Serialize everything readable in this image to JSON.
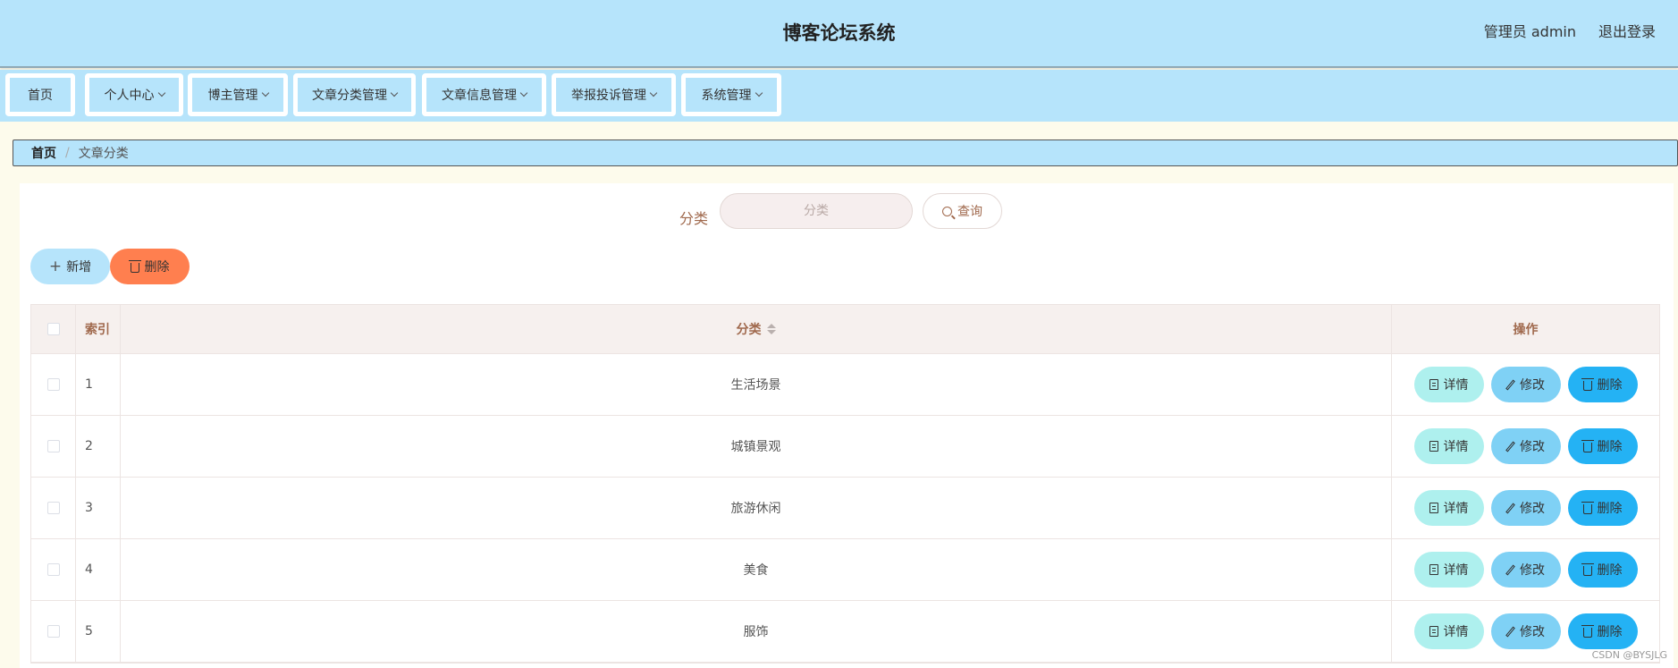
{
  "header": {
    "title": "博客论坛系统",
    "user": "管理员 admin",
    "logout": "退出登录"
  },
  "menu": [
    {
      "label": "首页",
      "has_dropdown": false
    },
    {
      "label": "个人中心",
      "has_dropdown": true
    },
    {
      "label": "博主管理",
      "has_dropdown": true
    },
    {
      "label": "文章分类管理",
      "has_dropdown": true
    },
    {
      "label": "文章信息管理",
      "has_dropdown": true
    },
    {
      "label": "举报投诉管理",
      "has_dropdown": true
    },
    {
      "label": "系统管理",
      "has_dropdown": true
    }
  ],
  "breadcrumb": {
    "home": "首页",
    "separator": "/",
    "current": "文章分类"
  },
  "search": {
    "label": "分类",
    "placeholder": "分类",
    "button": "查询"
  },
  "actions": {
    "add": "新增",
    "batch_delete": "删除"
  },
  "table": {
    "columns": {
      "index": "索引",
      "name": "分类",
      "ops": "操作"
    },
    "rows": [
      {
        "index": "1",
        "name": "生活场景"
      },
      {
        "index": "2",
        "name": "城镇景观"
      },
      {
        "index": "3",
        "name": "旅游休闲"
      },
      {
        "index": "4",
        "name": "美食"
      },
      {
        "index": "5",
        "name": "服饰"
      }
    ],
    "row_actions": {
      "detail": "详情",
      "edit": "修改",
      "delete": "删除"
    }
  },
  "watermark": "CSDN @BYSJLG",
  "colors": {
    "header_bg": "#b6e4fb",
    "page_bg": "#fdfbec",
    "accent_text": "#a0694d",
    "danger": "#ff7f4f",
    "detail_btn": "#aef0ee",
    "edit_btn": "#7fd1f5",
    "delete_btn": "#24b2f4"
  }
}
